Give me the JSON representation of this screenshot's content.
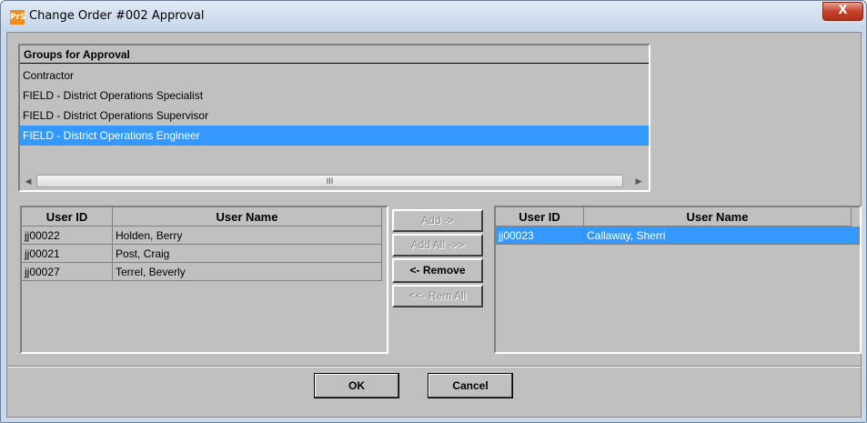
{
  "window": {
    "title": "Change Order #002 Approval",
    "icon_text": "PrS",
    "close_glyph": "X"
  },
  "groups": {
    "header": "Groups for Approval",
    "items": [
      "Contractor",
      "FIELD - District Operations Specialist",
      "FIELD - District Operations Supervisor",
      "FIELD - District Operations Engineer"
    ],
    "selected_index": 3,
    "scroll_grip": "III"
  },
  "available_users": {
    "columns": [
      "User ID",
      "User Name"
    ],
    "rows": [
      {
        "id": "jj00022",
        "name": "Holden, Berry"
      },
      {
        "id": "jj00021",
        "name": "Post, Craig"
      },
      {
        "id": "jj00027",
        "name": "Terrel, Beverly"
      }
    ]
  },
  "selected_users": {
    "columns": [
      "User ID",
      "User Name"
    ],
    "rows": [
      {
        "id": "jj00023",
        "name": "Callaway, Sherri"
      }
    ]
  },
  "transfer_buttons": {
    "add": "Add ->",
    "add_all": "Add All ->>",
    "remove": "<- Remove",
    "remove_all": "<<- Rem All"
  },
  "dialog_buttons": {
    "ok": "OK",
    "cancel": "Cancel"
  },
  "colors": {
    "selection": "#3399ff",
    "face": "#c0c0c0",
    "close_red": "#c8432b"
  }
}
